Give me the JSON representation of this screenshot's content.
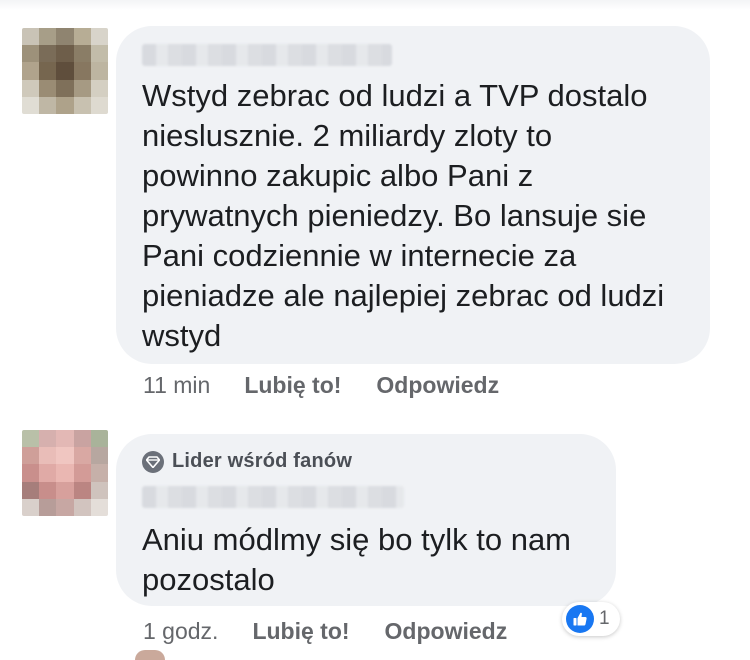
{
  "colors": {
    "bubble": "#f0f2f5",
    "text": "#1c1e21",
    "meta": "#65676b",
    "like_blue": "#1877f2"
  },
  "comments": [
    {
      "author_visible": false,
      "text": "Wstyd zebrac od ludzi a TVP dostalo\nnieslusznіe. 2 miliardy zloty to\npowinno zakupic albo Pani z\nprywatnych pieniedzy. Bo lansuje sie\nPani codziennie w internecie za\npieniadze ale najlepiej zebrac od ludzi\nwstyd",
      "time": "11 min",
      "like_label": "Lubię to!",
      "reply_label": "Odpowiedz",
      "avatar_palette": [
        "#c9c3b6",
        "#a79e88",
        "#8f8470",
        "#b7ad95",
        "#d8d4ca",
        "#9d917a",
        "#7a6c58",
        "#6e5e4a",
        "#8a7d66",
        "#c2bca9",
        "#b0a38c",
        "#76664f",
        "#5f4e3c",
        "#877760",
        "#bdb5a1",
        "#cfc9bb",
        "#9a8c74",
        "#7f705a",
        "#a69a83",
        "#d4cfc2",
        "#e0ddd4",
        "#bfb7a5",
        "#aea28a",
        "#c8c1b0",
        "#dedad0"
      ]
    },
    {
      "author_visible": false,
      "badge_icon": "diamond-icon",
      "badge_label": "Lider wśród fanów",
      "text": "Aniu módlmy się bo tylk to nam\npozostalo",
      "time": "1 godz.",
      "like_label": "Lubię to!",
      "reply_label": "Odpowiedz",
      "reaction_icon": "thumbs-up-icon",
      "reaction_count": "1",
      "avatar_palette": [
        "#b9c0a8",
        "#d6b0ae",
        "#e3b8b5",
        "#c9a3a1",
        "#a9b39a",
        "#cf9f99",
        "#e9bdb8",
        "#f0c6c1",
        "#d9a8a3",
        "#b7a7a0",
        "#c98f8c",
        "#e0aaa6",
        "#eab7b2",
        "#d39b97",
        "#c6b0a9",
        "#a67e7b",
        "#c88e8b",
        "#d7a09c",
        "#bb8582",
        "#cfc3bd",
        "#d9d0cb",
        "#b79d99",
        "#c7a7a3",
        "#d2c4bf",
        "#e4ded9"
      ]
    }
  ]
}
